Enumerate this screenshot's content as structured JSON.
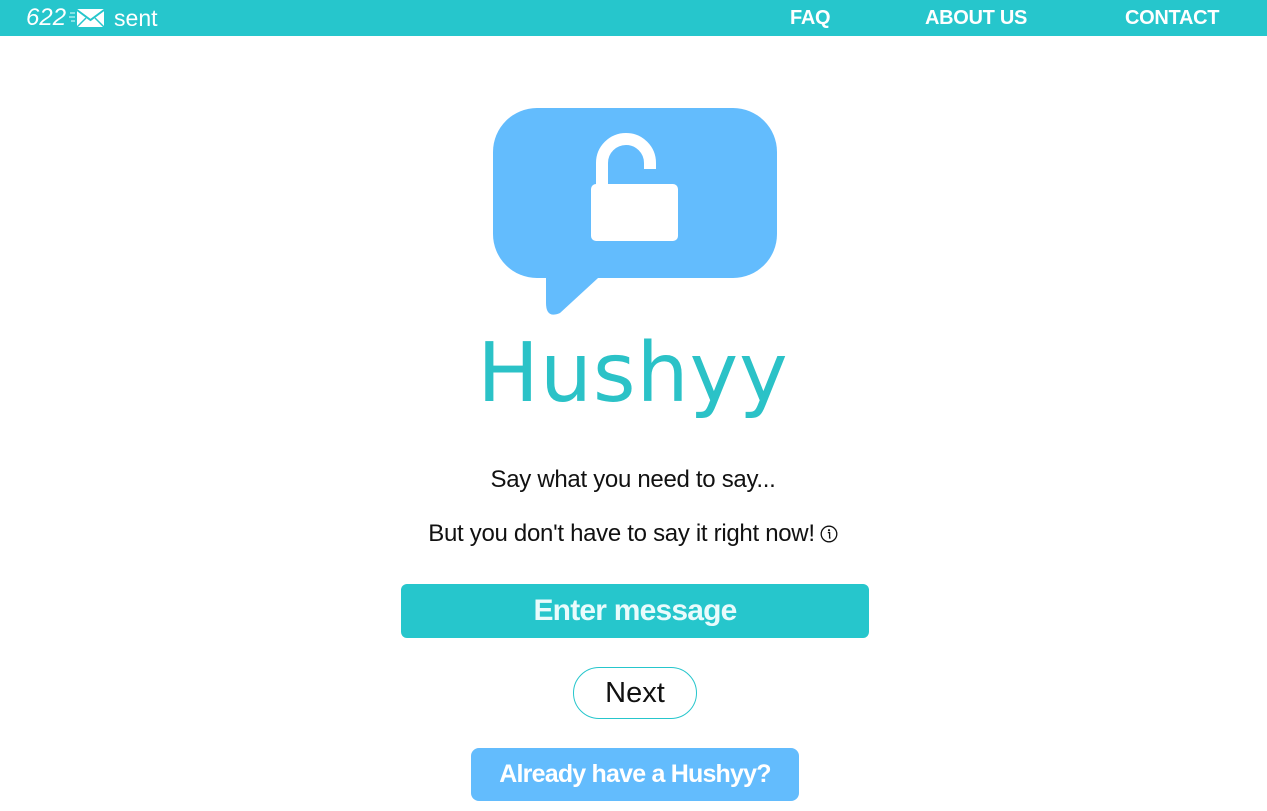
{
  "header": {
    "sent_count": "622",
    "sent_icon": "envelope-icon",
    "sent_label": "sent",
    "nav": {
      "faq": "FAQ",
      "about": "ABOUT US",
      "contact": "CONTACT"
    }
  },
  "hero": {
    "logo_icon": "speech-bubble-unlocked-padlock-icon",
    "brand": "Hushyy",
    "line1": "Say what you need to say...",
    "line2": "But you don't have to say it right now!",
    "info_icon": "info-icon"
  },
  "form": {
    "message_placeholder": "Enter message",
    "next_label": "Next",
    "already_label": "Already have a Hushyy?"
  },
  "colors": {
    "header_bg": "#26c6cc",
    "brand_text": "#2bc2c7",
    "logo_bubble": "#63bcfd",
    "enter_button": "#26c6cc",
    "already_button": "#63bcfd"
  }
}
